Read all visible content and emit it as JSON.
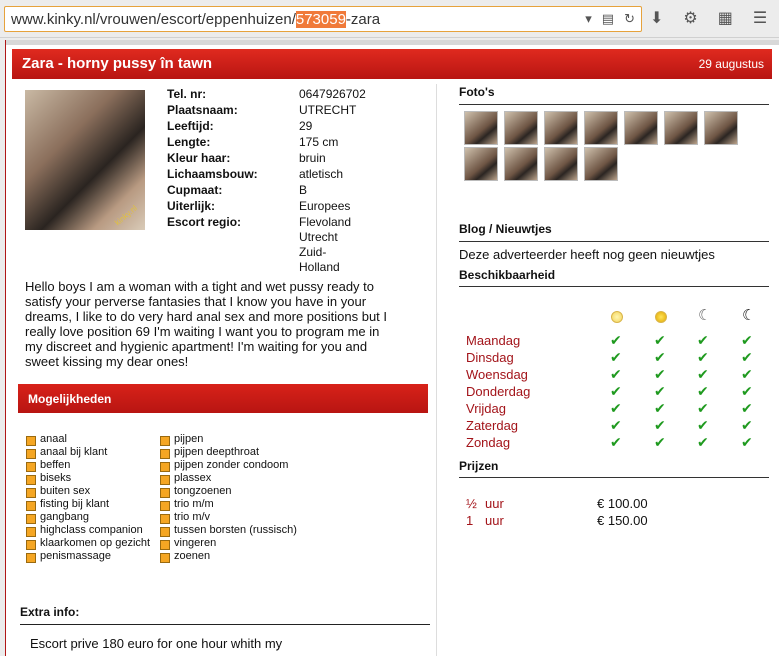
{
  "browser": {
    "url_prefix": "www.kinky.nl/vrouwen/escort/eppenhuizen/",
    "url_highlight": "573059",
    "url_suffix": "-zara"
  },
  "header": {
    "title": "Zara - horny pussy în tawn",
    "date": "29 augustus"
  },
  "details": {
    "rows": [
      {
        "label": "Tel. nr:",
        "value": "0647926702"
      },
      {
        "label": "Plaatsnaam:",
        "value": "UTRECHT"
      },
      {
        "label": "Leeftijd:",
        "value": "29"
      },
      {
        "label": "Lengte:",
        "value": "175 cm"
      },
      {
        "label": "Kleur haar:",
        "value": "bruin"
      },
      {
        "label": "Lichaamsbouw:",
        "value": "atletisch"
      },
      {
        "label": "Cupmaat:",
        "value": "B"
      },
      {
        "label": "Uiterlijk:",
        "value": "Europees"
      }
    ],
    "region_label": "Escort regio:",
    "regions": [
      "Flevoland",
      "Utrecht",
      "Zuid-Holland"
    ]
  },
  "description": "Hello boys I am a woman with a tight and wet pussy ready to satisfy your perverse fantasies that I know you have in your dreams, I like to do very hard anal sex and more positions but I really love position 69 I'm waiting I want you to program me in my discreet and hygienic apartment! I'm waiting for you and sweet kissing my dear ones!",
  "mogelijkheden": {
    "title": "Mogelijkheden",
    "col1": [
      "anaal",
      "anaal bij klant",
      "beffen",
      "biseks",
      "buiten sex",
      "fisting bij klant",
      "gangbang",
      "highclass companion",
      "klaarkomen op gezicht",
      "penismassage"
    ],
    "col2": [
      "pijpen",
      "pijpen deepthroat",
      "pijpen zonder condoom",
      "plassex",
      "tongzoenen",
      "trio m/m",
      "trio m/v",
      "tussen borsten (russisch)",
      "vingeren",
      "zoenen"
    ]
  },
  "extra": {
    "label": "Extra info:",
    "text": "Escort prive 180 euro for one hour whith my"
  },
  "photos": {
    "title": "Foto's",
    "count": 11
  },
  "blog": {
    "title": "Blog / Nieuwtjes",
    "text": "Deze adverteerder heeft nog geen nieuwtjes"
  },
  "availability": {
    "title": "Beschikbaarheid",
    "time_icons": [
      "morning-sun-icon",
      "afternoon-sun-icon",
      "evening-moon-icon",
      "night-moon-icon"
    ],
    "days": [
      "Maandag",
      "Dinsdag",
      "Woensdag",
      "Donderdag",
      "Vrijdag",
      "Zaterdag",
      "Zondag"
    ]
  },
  "prices": {
    "title": "Prijzen",
    "rows": [
      {
        "qty": "½",
        "unit": "uur",
        "price": "€ 100.00"
      },
      {
        "qty": "1",
        "unit": "uur",
        "price": "€ 150.00"
      }
    ]
  },
  "colors": {
    "brand_red": "#c41a16",
    "link_red": "#a3141a",
    "check_green": "#1f9a1f",
    "bullet_orange": "#f5a623"
  }
}
